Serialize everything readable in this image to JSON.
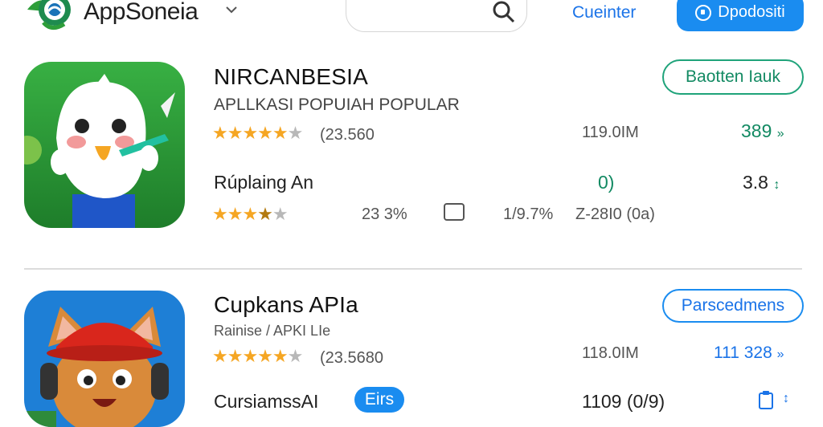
{
  "header": {
    "logo_icon": "globe-leaf-logo-icon",
    "logo_text": "AppSoneia",
    "dropdown_icon": "chevron-down-icon",
    "search_icon": "search-icon",
    "nav_link": "Cueinter",
    "primary_button": "Dpodositi",
    "primary_button_icon": "location-pin-icon"
  },
  "apps": [
    {
      "name": "NIRCANBESIA",
      "subtitle": "APLLKASI POPUIAH POPULAR",
      "rating_stars": 4.5,
      "rating_count": "(23.560",
      "size": "119.0IM",
      "action_label": "Baotten Iauk",
      "stat_value": "389",
      "stat_arrow": "»",
      "detail_label": "Rúplaing An",
      "detail_mid": "0)",
      "detail_right": "3.8",
      "detail_right_mark": "↕",
      "sub_rating_stars": 3.5,
      "sub_percent": "23 3%",
      "sub_icon": "sim-card-icon",
      "sub_ratio": "1/9.7%",
      "sub_size": "Z-28I0 (0a)",
      "colors": {
        "bg": "#2e9e3a",
        "bg_dark": "#1e7d2a",
        "mascot": "#ffffff",
        "shirt": "#1f56c8"
      }
    },
    {
      "name": "Cupkans APIa",
      "subtitle": "Rainise / APKI LIe",
      "rating_stars": 4.5,
      "rating_count": "(23.5680",
      "size": "118.0IM",
      "action_label": "Parscedmens",
      "stat_value": "111 328",
      "stat_arrow": "»",
      "detail_label": "CursiamssAI",
      "detail_pill": "Eirs",
      "detail_size": "1109 (0/9)",
      "detail_icon": "clipboard-icon",
      "detail_mark": "↕",
      "colors": {
        "bg": "#1e7fd6",
        "cap": "#d9261c",
        "face": "#d98a3a",
        "ears": "#f2b8a0"
      }
    }
  ],
  "colors": {
    "accent_blue": "#1a8cf0",
    "accent_green": "#138a63",
    "star": "#f5a623"
  }
}
